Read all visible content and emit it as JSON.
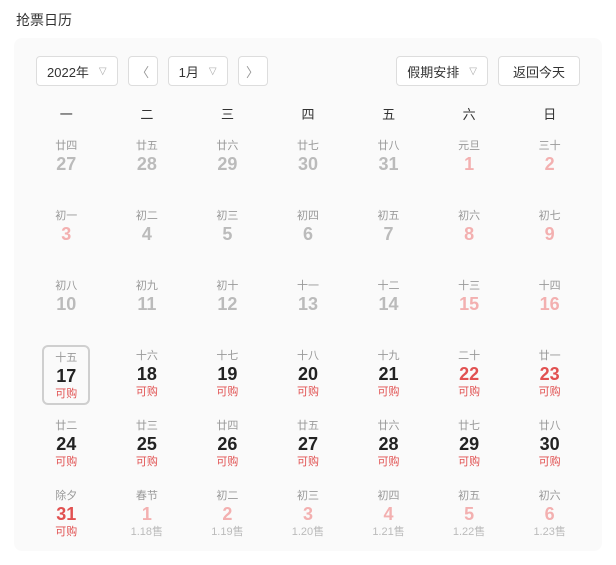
{
  "page": {
    "title": "抢票日历"
  },
  "toolbar": {
    "year_label": "2022年",
    "month_label": "1月",
    "holiday_label": "假期安排",
    "today_label": "返回今天"
  },
  "weekdays": [
    "一",
    "二",
    "三",
    "四",
    "五",
    "六",
    "日"
  ],
  "cells": [
    {
      "lunar": "廿四",
      "day": "27",
      "day_cls": "dim",
      "status": "",
      "status_cls": ""
    },
    {
      "lunar": "廿五",
      "day": "28",
      "day_cls": "dim",
      "status": "",
      "status_cls": ""
    },
    {
      "lunar": "廿六",
      "day": "29",
      "day_cls": "dim",
      "status": "",
      "status_cls": ""
    },
    {
      "lunar": "廿七",
      "day": "30",
      "day_cls": "dim",
      "status": "",
      "status_cls": ""
    },
    {
      "lunar": "廿八",
      "day": "31",
      "day_cls": "dim",
      "status": "",
      "status_cls": ""
    },
    {
      "lunar": "元旦",
      "day": "1",
      "day_cls": "dimred",
      "status": "",
      "status_cls": ""
    },
    {
      "lunar": "三十",
      "day": "2",
      "day_cls": "dimred",
      "status": "",
      "status_cls": ""
    },
    {
      "lunar": "初一",
      "day": "3",
      "day_cls": "dimred",
      "status": "",
      "status_cls": ""
    },
    {
      "lunar": "初二",
      "day": "4",
      "day_cls": "dim",
      "status": "",
      "status_cls": ""
    },
    {
      "lunar": "初三",
      "day": "5",
      "day_cls": "dim",
      "status": "",
      "status_cls": ""
    },
    {
      "lunar": "初四",
      "day": "6",
      "day_cls": "dim",
      "status": "",
      "status_cls": ""
    },
    {
      "lunar": "初五",
      "day": "7",
      "day_cls": "dim",
      "status": "",
      "status_cls": ""
    },
    {
      "lunar": "初六",
      "day": "8",
      "day_cls": "dimred",
      "status": "",
      "status_cls": ""
    },
    {
      "lunar": "初七",
      "day": "9",
      "day_cls": "dimred",
      "status": "",
      "status_cls": ""
    },
    {
      "lunar": "初八",
      "day": "10",
      "day_cls": "dim",
      "status": "",
      "status_cls": ""
    },
    {
      "lunar": "初九",
      "day": "11",
      "day_cls": "dim",
      "status": "",
      "status_cls": ""
    },
    {
      "lunar": "初十",
      "day": "12",
      "day_cls": "dim",
      "status": "",
      "status_cls": ""
    },
    {
      "lunar": "十一",
      "day": "13",
      "day_cls": "dim",
      "status": "",
      "status_cls": ""
    },
    {
      "lunar": "十二",
      "day": "14",
      "day_cls": "dim",
      "status": "",
      "status_cls": ""
    },
    {
      "lunar": "十三",
      "day": "15",
      "day_cls": "dimred",
      "status": "",
      "status_cls": ""
    },
    {
      "lunar": "十四",
      "day": "16",
      "day_cls": "dimred",
      "status": "",
      "status_cls": ""
    },
    {
      "lunar": "十五",
      "day": "17",
      "day_cls": "normal",
      "status": "可购",
      "status_cls": "buy",
      "today": true
    },
    {
      "lunar": "十六",
      "day": "18",
      "day_cls": "normal",
      "status": "可购",
      "status_cls": "buy"
    },
    {
      "lunar": "十七",
      "day": "19",
      "day_cls": "normal",
      "status": "可购",
      "status_cls": "buy"
    },
    {
      "lunar": "十八",
      "day": "20",
      "day_cls": "normal",
      "status": "可购",
      "status_cls": "buy"
    },
    {
      "lunar": "十九",
      "day": "21",
      "day_cls": "normal",
      "status": "可购",
      "status_cls": "buy"
    },
    {
      "lunar": "二十",
      "day": "22",
      "day_cls": "red",
      "status": "可购",
      "status_cls": "buy"
    },
    {
      "lunar": "廿一",
      "day": "23",
      "day_cls": "red",
      "status": "可购",
      "status_cls": "buy"
    },
    {
      "lunar": "廿二",
      "day": "24",
      "day_cls": "normal",
      "status": "可购",
      "status_cls": "buy"
    },
    {
      "lunar": "廿三",
      "day": "25",
      "day_cls": "normal",
      "status": "可购",
      "status_cls": "buy"
    },
    {
      "lunar": "廿四",
      "day": "26",
      "day_cls": "normal",
      "status": "可购",
      "status_cls": "buy"
    },
    {
      "lunar": "廿五",
      "day": "27",
      "day_cls": "normal",
      "status": "可购",
      "status_cls": "buy"
    },
    {
      "lunar": "廿六",
      "day": "28",
      "day_cls": "normal",
      "status": "可购",
      "status_cls": "buy"
    },
    {
      "lunar": "廿七",
      "day": "29",
      "day_cls": "normal",
      "status": "可购",
      "status_cls": "buy"
    },
    {
      "lunar": "廿八",
      "day": "30",
      "day_cls": "normal",
      "status": "可购",
      "status_cls": "buy"
    },
    {
      "lunar": "除夕",
      "day": "31",
      "day_cls": "red",
      "status": "可购",
      "status_cls": "buy"
    },
    {
      "lunar": "春节",
      "day": "1",
      "day_cls": "dimred",
      "status": "1.18售",
      "status_cls": "sale"
    },
    {
      "lunar": "初二",
      "day": "2",
      "day_cls": "dimred",
      "status": "1.19售",
      "status_cls": "sale"
    },
    {
      "lunar": "初三",
      "day": "3",
      "day_cls": "dimred",
      "status": "1.20售",
      "status_cls": "sale"
    },
    {
      "lunar": "初四",
      "day": "4",
      "day_cls": "dimred",
      "status": "1.21售",
      "status_cls": "sale"
    },
    {
      "lunar": "初五",
      "day": "5",
      "day_cls": "dimred",
      "status": "1.22售",
      "status_cls": "sale"
    },
    {
      "lunar": "初六",
      "day": "6",
      "day_cls": "dimred",
      "status": "1.23售",
      "status_cls": "sale"
    }
  ]
}
